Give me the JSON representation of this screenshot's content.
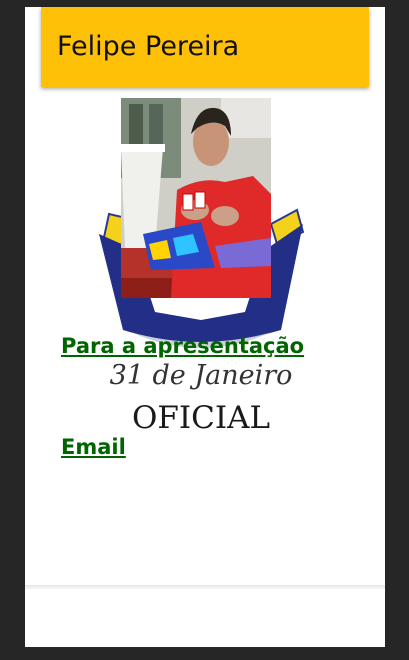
{
  "header": {
    "title": "Felipe Pereira",
    "color": "#ffc107"
  },
  "logo": {
    "line1": "31 de Janeiro",
    "line2": "OFICIAL"
  },
  "links": {
    "presentation": "Para a apresentação",
    "email": "Email",
    "color": "#006400"
  }
}
